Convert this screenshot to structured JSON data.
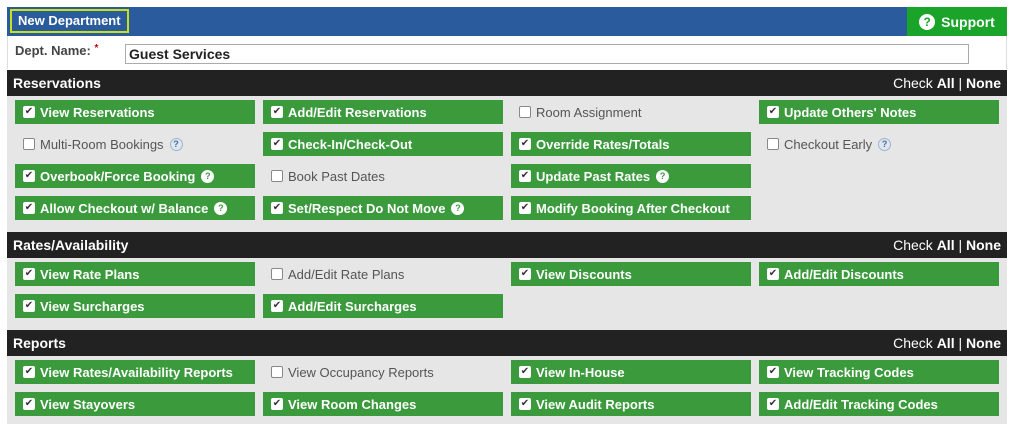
{
  "header": {
    "title": "New Department",
    "support_label": "Support",
    "support_icon": "question-circle-icon"
  },
  "dept": {
    "label": "Dept. Name:",
    "required_mark": "*",
    "value": "Guest Services"
  },
  "check_all": "All",
  "check_prefix": "Check",
  "check_sep": "|",
  "check_none": "None",
  "sections": [
    {
      "title": "Reservations",
      "items": [
        {
          "label": "View Reservations",
          "checked": true,
          "help": false
        },
        {
          "label": "Add/Edit Reservations",
          "checked": true,
          "help": false
        },
        {
          "label": "Room Assignment",
          "checked": false,
          "help": false
        },
        {
          "label": "Update Others' Notes",
          "checked": true,
          "help": false
        },
        {
          "label": "Multi-Room Bookings",
          "checked": false,
          "help": true
        },
        {
          "label": "Check-In/Check-Out",
          "checked": true,
          "help": false
        },
        {
          "label": "Override Rates/Totals",
          "checked": true,
          "help": false
        },
        {
          "label": "Checkout Early",
          "checked": false,
          "help": true
        },
        {
          "label": "Overbook/Force Booking",
          "checked": true,
          "help": true
        },
        {
          "label": "Book Past Dates",
          "checked": false,
          "help": false
        },
        {
          "label": "Update Past Rates",
          "checked": true,
          "help": true
        },
        null,
        {
          "label": "Allow Checkout w/ Balance",
          "checked": true,
          "help": true
        },
        {
          "label": "Set/Respect Do Not Move",
          "checked": true,
          "help": true
        },
        {
          "label": "Modify Booking After Checkout",
          "checked": true,
          "help": false
        }
      ]
    },
    {
      "title": "Rates/Availability",
      "items": [
        {
          "label": "View Rate Plans",
          "checked": true,
          "help": false
        },
        {
          "label": "Add/Edit Rate Plans",
          "checked": false,
          "help": false
        },
        {
          "label": "View Discounts",
          "checked": true,
          "help": false
        },
        {
          "label": "Add/Edit Discounts",
          "checked": true,
          "help": false
        },
        {
          "label": "View Surcharges",
          "checked": true,
          "help": false
        },
        {
          "label": "Add/Edit Surcharges",
          "checked": true,
          "help": false
        }
      ]
    },
    {
      "title": "Reports",
      "items": [
        {
          "label": "View Rates/Availability Reports",
          "checked": true,
          "help": false
        },
        {
          "label": "View Occupancy Reports",
          "checked": false,
          "help": false
        },
        {
          "label": "View In-House",
          "checked": true,
          "help": false
        },
        {
          "label": "View Tracking Codes",
          "checked": true,
          "help": false
        },
        {
          "label": "View Stayovers",
          "checked": true,
          "help": false
        },
        {
          "label": "View Room Changes",
          "checked": true,
          "help": false
        },
        {
          "label": "View Audit Reports",
          "checked": true,
          "help": false
        },
        {
          "label": "Add/Edit Tracking Codes",
          "checked": true,
          "help": false
        }
      ]
    }
  ]
}
